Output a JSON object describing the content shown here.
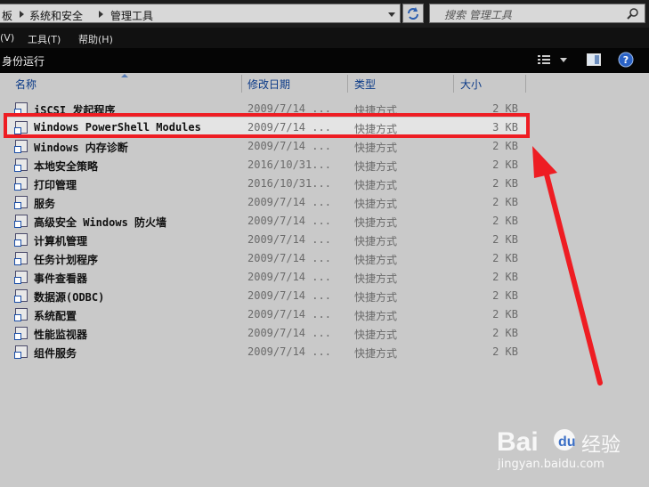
{
  "address": {
    "crumbs": [
      "板",
      "系统和安全",
      "管理工具"
    ]
  },
  "search": {
    "placeholder": "搜索 管理工具"
  },
  "menu": {
    "items": [
      "(V)",
      "工具(T)",
      "帮助(H)"
    ]
  },
  "toolbar": {
    "run_as": "身份运行"
  },
  "columns": {
    "name": "名称",
    "date": "修改日期",
    "type": "类型",
    "size": "大小"
  },
  "files": [
    {
      "name": "iSCSI 发起程序",
      "date": "2009/7/14 ...",
      "type": "快捷方式",
      "size": "2 KB"
    },
    {
      "name": "Windows PowerShell Modules",
      "date": "2009/7/14 ...",
      "type": "快捷方式",
      "size": "3 KB"
    },
    {
      "name": "Windows 内存诊断",
      "date": "2009/7/14 ...",
      "type": "快捷方式",
      "size": "2 KB"
    },
    {
      "name": "本地安全策略",
      "date": "2016/10/31...",
      "type": "快捷方式",
      "size": "2 KB"
    },
    {
      "name": "打印管理",
      "date": "2016/10/31...",
      "type": "快捷方式",
      "size": "2 KB"
    },
    {
      "name": "服务",
      "date": "2009/7/14 ...",
      "type": "快捷方式",
      "size": "2 KB"
    },
    {
      "name": "高级安全 Windows 防火墙",
      "date": "2009/7/14 ...",
      "type": "快捷方式",
      "size": "2 KB"
    },
    {
      "name": "计算机管理",
      "date": "2009/7/14 ...",
      "type": "快捷方式",
      "size": "2 KB"
    },
    {
      "name": "任务计划程序",
      "date": "2009/7/14 ...",
      "type": "快捷方式",
      "size": "2 KB"
    },
    {
      "name": "事件查看器",
      "date": "2009/7/14 ...",
      "type": "快捷方式",
      "size": "2 KB"
    },
    {
      "name": "数据源(ODBC)",
      "date": "2009/7/14 ...",
      "type": "快捷方式",
      "size": "2 KB"
    },
    {
      "name": "系统配置",
      "date": "2009/7/14 ...",
      "type": "快捷方式",
      "size": "2 KB"
    },
    {
      "name": "性能监视器",
      "date": "2009/7/14 ...",
      "type": "快捷方式",
      "size": "2 KB"
    },
    {
      "name": "组件服务",
      "date": "2009/7/14 ...",
      "type": "快捷方式",
      "size": "2 KB"
    }
  ],
  "annotation": {
    "highlight_color": "#ee1d23",
    "arrow_color": "#ee1d23"
  },
  "watermark": {
    "brand": "Baidu经验",
    "url": "jingyan.baidu.com"
  },
  "colors": {
    "header_text": "#0b3a88",
    "window_bg": "#c9c9c9"
  }
}
